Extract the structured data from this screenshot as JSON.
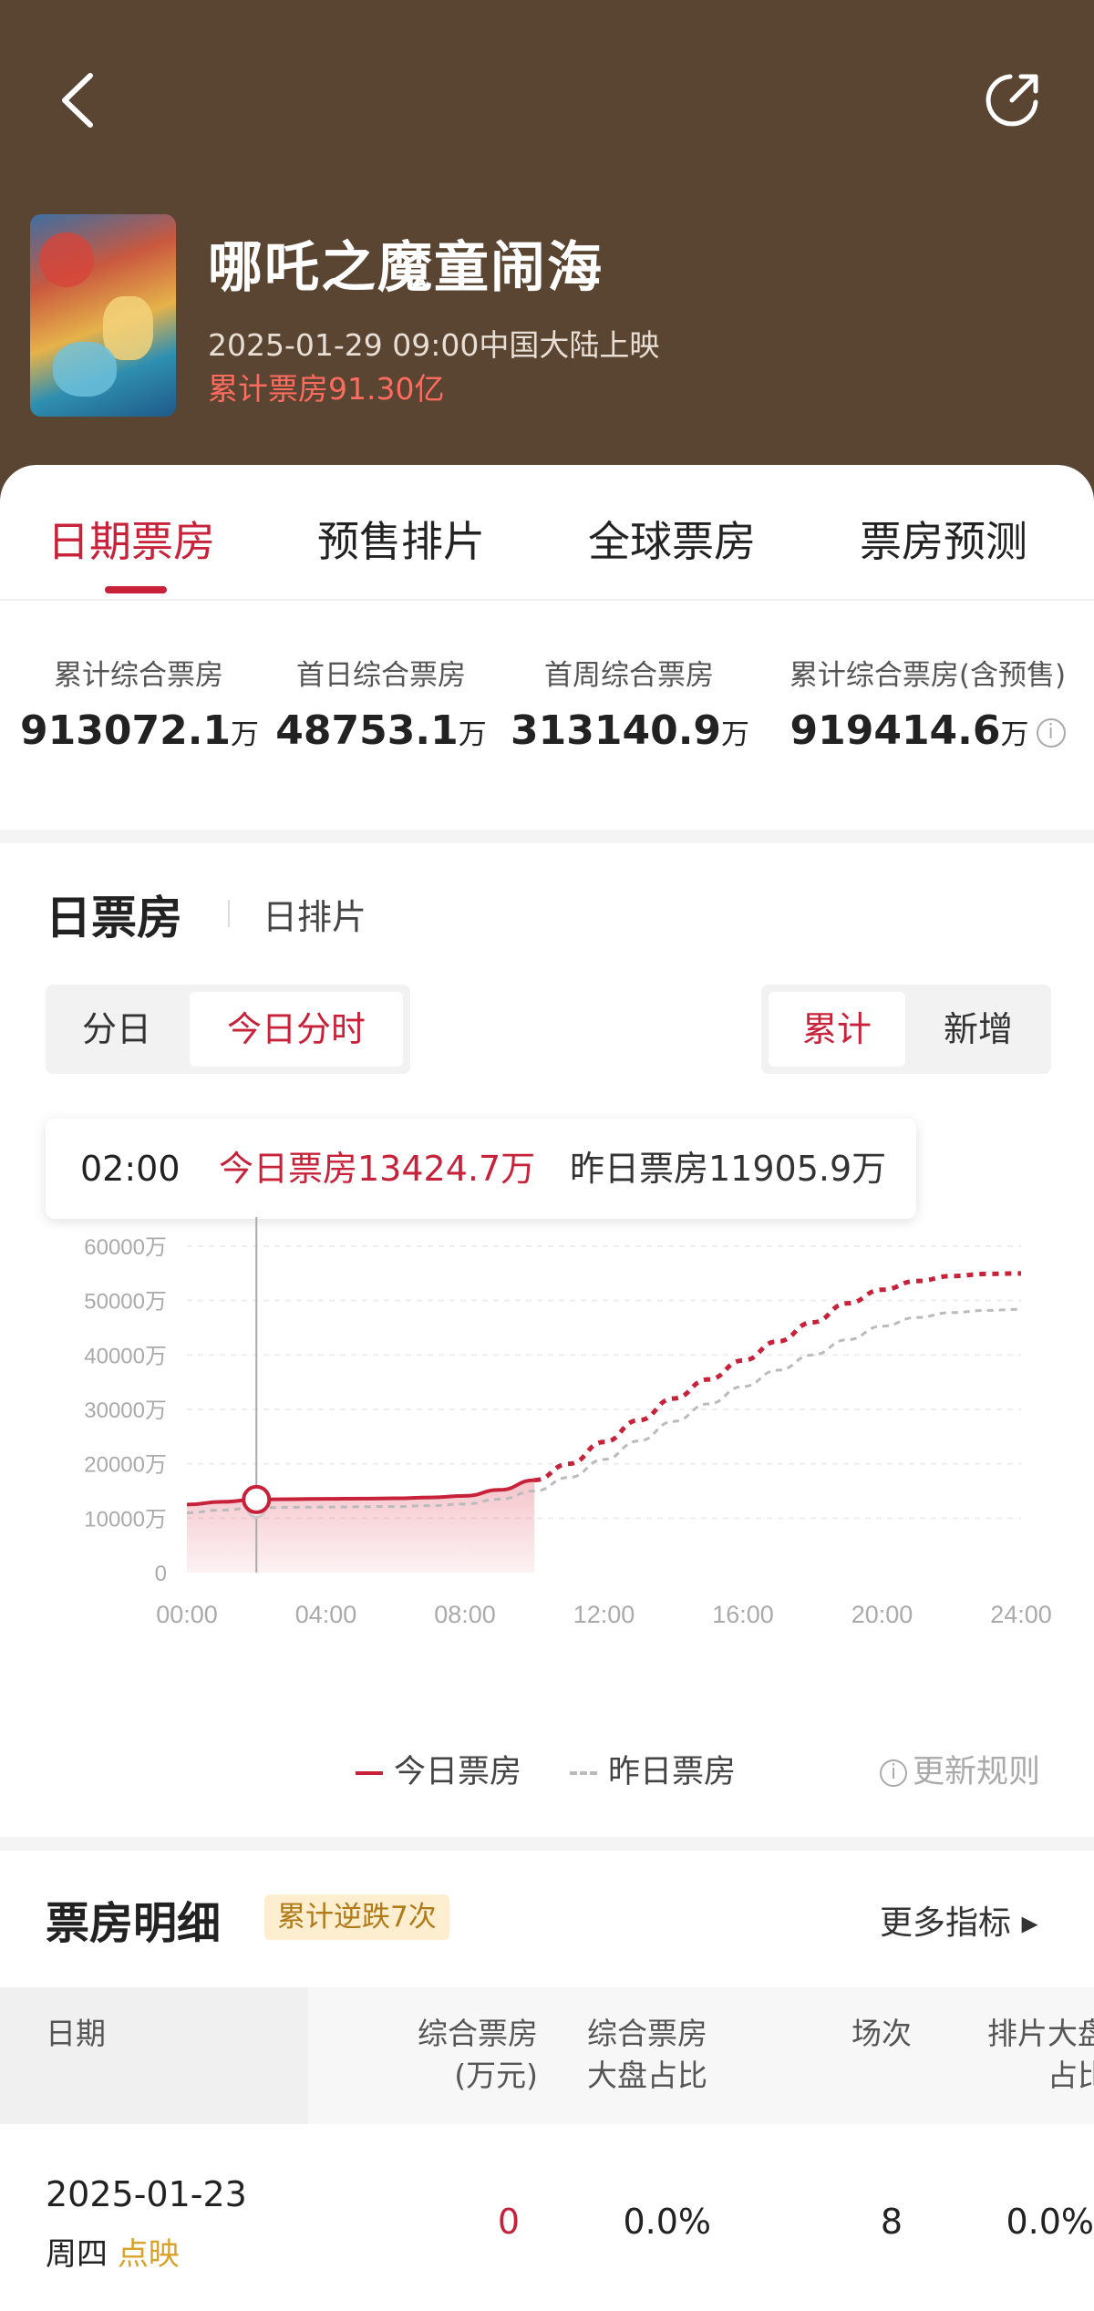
{
  "header": {
    "movie_title": "哪吒之魔童闹海",
    "release_info": "2025-01-29 09:00中国大陆上映",
    "total_box_office": "累计票房91.30亿"
  },
  "tabs": [
    {
      "label": "日期票房",
      "active": true
    },
    {
      "label": "预售排片",
      "active": false
    },
    {
      "label": "全球票房",
      "active": false
    },
    {
      "label": "票房预测",
      "active": false
    }
  ],
  "stats": [
    {
      "label": "累计综合票房",
      "value": "913072.1",
      "unit": "万"
    },
    {
      "label": "首日综合票房",
      "value": "48753.1",
      "unit": "万"
    },
    {
      "label": "首周综合票房",
      "value": "313140.9",
      "unit": "万"
    },
    {
      "label": "累计综合票房(含预售)",
      "value": "919414.6",
      "unit": "万",
      "info_icon": "info-icon"
    }
  ],
  "chart_section": {
    "title": "日票房",
    "secondary_tab": "日排片",
    "mode_left": [
      "分日",
      "今日分时"
    ],
    "mode_left_selected": "今日分时",
    "mode_right": [
      "累计",
      "新增"
    ],
    "mode_right_selected": "累计",
    "tooltip": {
      "time": "02:00",
      "today": "今日票房13424.7万",
      "yesterday": "昨日票房11905.9万"
    },
    "legend": {
      "today": "今日票房",
      "yesterday": "昨日票房",
      "update_rule": "更新规则"
    }
  },
  "chart_data": {
    "type": "line",
    "x_ticks": [
      "00:00",
      "04:00",
      "08:00",
      "12:00",
      "16:00",
      "20:00",
      "24:00"
    ],
    "y_ticks": [
      "0",
      "10000万",
      "20000万",
      "30000万",
      "40000万",
      "50000万",
      "60000万"
    ],
    "ylim": [
      0,
      60000
    ],
    "xlim": [
      0,
      24
    ],
    "cursor_x": 2,
    "series": [
      {
        "name": "今日票房",
        "color": "#c8213a",
        "x": [
          0,
          1,
          2,
          3,
          4,
          5,
          6,
          7,
          8,
          9,
          10,
          11,
          12,
          13,
          14,
          15,
          16,
          17,
          18,
          19,
          20,
          21,
          22,
          23,
          24
        ],
        "y": [
          12500,
          13000,
          13424.7,
          13500,
          13550,
          13600,
          13650,
          13800,
          14100,
          15200,
          17000,
          20000,
          24000,
          28000,
          32000,
          35500,
          39000,
          42500,
          46000,
          49500,
          52000,
          53600,
          54500,
          54900,
          55000
        ],
        "actual_until": 10
      },
      {
        "name": "昨日票房",
        "color": "#bbbbbb",
        "x": [
          0,
          1,
          2,
          3,
          4,
          5,
          6,
          7,
          8,
          9,
          10,
          11,
          12,
          13,
          14,
          15,
          16,
          17,
          18,
          19,
          20,
          21,
          22,
          23,
          24
        ],
        "y": [
          11000,
          11500,
          11905.9,
          12000,
          12050,
          12100,
          12150,
          12300,
          12600,
          13500,
          15000,
          17500,
          20800,
          24200,
          27800,
          31000,
          34200,
          37200,
          40000,
          42800,
          45300,
          46900,
          47800,
          48200,
          48400
        ]
      }
    ]
  },
  "detail": {
    "title": "票房明细",
    "badge": "累计逆跌7次",
    "more_label": "更多指标 ▸",
    "columns": [
      "日期",
      "综合票房\n(万元)",
      "综合票房\n大盘占比",
      "场次",
      "排片大盘\n占比"
    ],
    "rows": [
      {
        "date": "2025-01-23",
        "weekday": "周四",
        "tag": "点映",
        "box": "0",
        "share": "0.0%",
        "shows": "8",
        "screen_share": "0.0%"
      }
    ]
  },
  "colors": {
    "header_bg": "#5a4533",
    "accent": "#c8213a",
    "total_red": "#ff6b5f",
    "badge_bg": "#fdeecf"
  }
}
